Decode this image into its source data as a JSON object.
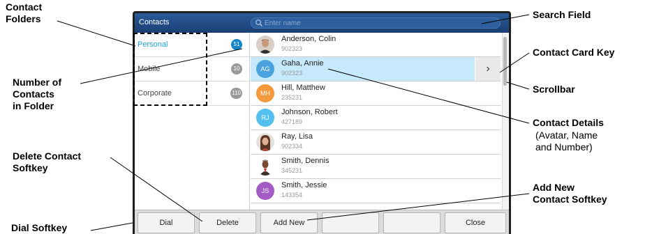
{
  "window": {
    "title": "Contacts"
  },
  "search": {
    "placeholder": "Enter name"
  },
  "folders": [
    {
      "label": "Personal",
      "count": "51",
      "selected": true
    },
    {
      "label": "Mobile",
      "count": "10",
      "selected": false
    },
    {
      "label": "Corporate",
      "count": "110",
      "selected": false
    }
  ],
  "contacts": [
    {
      "name": "Anderson, Colin",
      "number": "902323",
      "initials": "",
      "avatar_color": "#6b5a4e",
      "photo": true,
      "selected": false
    },
    {
      "name": "Gaha, Annie",
      "number": "902323",
      "initials": "AG",
      "avatar_color": "#4aa3de",
      "photo": false,
      "selected": true
    },
    {
      "name": "Hill, Matthew",
      "number": "235231",
      "initials": "MH",
      "avatar_color": "#f39a3c",
      "photo": false,
      "selected": false
    },
    {
      "name": "Johnson, Robert",
      "number": "427189",
      "initials": "RJ",
      "avatar_color": "#53c0ef",
      "photo": false,
      "selected": false
    },
    {
      "name": "Ray, Lisa",
      "number": "902334",
      "initials": "",
      "avatar_color": "#7a4a34",
      "photo": true,
      "selected": false
    },
    {
      "name": "Smith, Dennis",
      "number": "345231",
      "initials": "",
      "avatar_color": "#5b3b2a",
      "photo": true,
      "selected": false
    },
    {
      "name": "Smith, Jessie",
      "number": "143354",
      "initials": "JS",
      "avatar_color": "#a35bc6",
      "photo": false,
      "selected": false
    }
  ],
  "card_key": {
    "glyph": "›"
  },
  "softkeys": [
    "Dial",
    "Delete",
    "Add New",
    "",
    "",
    "Close"
  ],
  "callouts": {
    "contact_folders": "Contact\nFolders",
    "number_of_contacts": "Number of\nContacts\nin Folder",
    "delete_softkey": "Delete Contact\nSoftkey",
    "dial_softkey": "Dial Softkey",
    "search_field": "Search Field",
    "contact_card_key": "Contact Card Key",
    "scrollbar": "Scrollbar",
    "contact_details": "Contact Details",
    "contact_details_sub": "(Avatar, Name\n and Number)",
    "add_new_softkey": "Add New\nContact Softkey"
  },
  "colors": {
    "titlebar": "#1b3f73",
    "selected_row": "#c6e9fb",
    "folder_selected_text": "#1da3d8"
  }
}
